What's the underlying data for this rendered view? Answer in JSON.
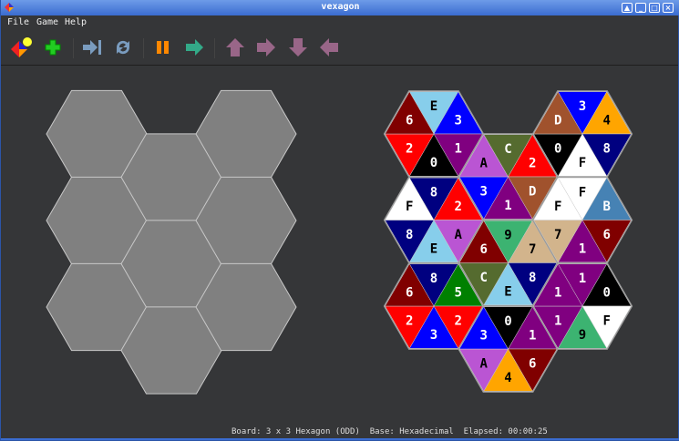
{
  "window": {
    "title": "vexagon"
  },
  "menu": {
    "file": "File",
    "game": "Game",
    "help": "Help"
  },
  "toolbar": [
    "new-game",
    "add",
    "skip-to-end",
    "restart",
    "pause",
    "play",
    "move-up",
    "move-right",
    "move-down",
    "move-left"
  ],
  "status": {
    "text": "Board: 3 x 3 Hexagon (ODD)  Base: Hexadecimal  Elapsed: 00:00:25"
  },
  "board": {
    "columns": 3,
    "rows": 3,
    "empty_color": "#808080"
  },
  "pieces_note_order": "top, upper-right, lower-right, bottom, lower-left, upper-left",
  "pieces": [
    {
      "col": 0,
      "row": 0,
      "tri": [
        [
          "E",
          "#87ceeb"
        ],
        [
          "3",
          "#0000ff"
        ],
        [
          "1",
          "#800080"
        ],
        [
          "0",
          "#000000"
        ],
        [
          "2",
          "#ff0000"
        ],
        [
          "6",
          "#800000"
        ]
      ]
    },
    {
      "col": 1,
      "row": 0,
      "tri": [
        [
          "C",
          "#556b2f"
        ],
        [
          "2",
          "#ff0000"
        ],
        [
          "D",
          "#a0522d"
        ],
        [
          "1",
          "#800080"
        ],
        [
          "3",
          "#0000ff"
        ],
        [
          "A",
          "#ba55d3"
        ]
      ]
    },
    {
      "col": 2,
      "row": 0,
      "tri": [
        [
          "3",
          "#0000ff"
        ],
        [
          "4",
          "#ffa500"
        ],
        [
          "8",
          "#000080"
        ],
        [
          "F",
          "#ffffff"
        ],
        [
          "0",
          "#000000"
        ],
        [
          "D",
          "#a0522d"
        ]
      ]
    },
    {
      "col": 0,
      "row": 1,
      "tri": [
        [
          "8",
          "#000080"
        ],
        [
          "2",
          "#ff0000"
        ],
        [
          "A",
          "#ba55d3"
        ],
        [
          "E",
          "#87ceeb"
        ],
        [
          "8",
          "#000080"
        ],
        [
          "F",
          "#ffffff"
        ]
      ]
    },
    {
      "col": 1,
      "row": 1,
      "tri": [
        [
          "9",
          "#3cb371"
        ],
        [
          "7",
          "#d2b48c"
        ],
        [
          "8",
          "#000080"
        ],
        [
          "E",
          "#87ceeb"
        ],
        [
          "C",
          "#556b2f"
        ],
        [
          "6",
          "#800000"
        ]
      ]
    },
    {
      "col": 2,
      "row": 1,
      "tri": [
        [
          "F",
          "#ffffff"
        ],
        [
          "B",
          "#4682b4"
        ],
        [
          "6",
          "#800000"
        ],
        [
          "1",
          "#800080"
        ],
        [
          "7",
          "#d2b48c"
        ],
        [
          "F",
          "#ffffff"
        ]
      ]
    },
    {
      "col": 0,
      "row": 2,
      "tri": [
        [
          "8",
          "#000080"
        ],
        [
          "5",
          "#008000"
        ],
        [
          "2",
          "#ff0000"
        ],
        [
          "3",
          "#0000ff"
        ],
        [
          "2",
          "#ff0000"
        ],
        [
          "6",
          "#800000"
        ]
      ]
    },
    {
      "col": 1,
      "row": 2,
      "tri": [
        [
          "0",
          "#000000"
        ],
        [
          "1",
          "#800080"
        ],
        [
          "6",
          "#800000"
        ],
        [
          "4",
          "#ffa500"
        ],
        [
          "A",
          "#ba55d3"
        ],
        [
          "3",
          "#0000ff"
        ]
      ]
    },
    {
      "col": 2,
      "row": 2,
      "tri": [
        [
          "1",
          "#800080"
        ],
        [
          "0",
          "#000000"
        ],
        [
          "F",
          "#ffffff"
        ],
        [
          "9",
          "#3cb371"
        ],
        [
          "1",
          "#800080"
        ],
        [
          "1",
          "#800080"
        ]
      ]
    }
  ]
}
